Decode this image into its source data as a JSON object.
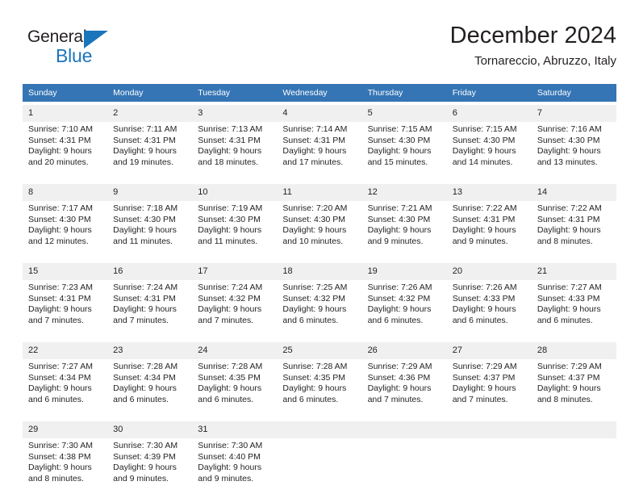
{
  "brand": {
    "name_part1": "General",
    "name_part2": "Blue",
    "accent_color": "#1b75bb",
    "triangle_icon": "logo-triangle-icon"
  },
  "header": {
    "title": "December 2024",
    "subtitle": "Tornareccio, Abruzzo, Italy"
  },
  "theme": {
    "header_row_bg": "#3575b5",
    "daynum_bg": "#f0f0f0",
    "text_color": "#231f20",
    "separator_color": "#3575b5"
  },
  "weekday_headers": [
    "Sunday",
    "Monday",
    "Tuesday",
    "Wednesday",
    "Thursday",
    "Friday",
    "Saturday"
  ],
  "labels": {
    "sunrise_prefix": "Sunrise:",
    "sunset_prefix": "Sunset:",
    "daylight_prefix": "Daylight:"
  },
  "weeks": [
    {
      "days": [
        {
          "num": "1",
          "sunrise": "Sunrise: 7:10 AM",
          "sunset": "Sunset: 4:31 PM",
          "daylight_line1": "Daylight: 9 hours",
          "daylight_line2": "and 20 minutes."
        },
        {
          "num": "2",
          "sunrise": "Sunrise: 7:11 AM",
          "sunset": "Sunset: 4:31 PM",
          "daylight_line1": "Daylight: 9 hours",
          "daylight_line2": "and 19 minutes."
        },
        {
          "num": "3",
          "sunrise": "Sunrise: 7:13 AM",
          "sunset": "Sunset: 4:31 PM",
          "daylight_line1": "Daylight: 9 hours",
          "daylight_line2": "and 18 minutes."
        },
        {
          "num": "4",
          "sunrise": "Sunrise: 7:14 AM",
          "sunset": "Sunset: 4:31 PM",
          "daylight_line1": "Daylight: 9 hours",
          "daylight_line2": "and 17 minutes."
        },
        {
          "num": "5",
          "sunrise": "Sunrise: 7:15 AM",
          "sunset": "Sunset: 4:30 PM",
          "daylight_line1": "Daylight: 9 hours",
          "daylight_line2": "and 15 minutes."
        },
        {
          "num": "6",
          "sunrise": "Sunrise: 7:15 AM",
          "sunset": "Sunset: 4:30 PM",
          "daylight_line1": "Daylight: 9 hours",
          "daylight_line2": "and 14 minutes."
        },
        {
          "num": "7",
          "sunrise": "Sunrise: 7:16 AM",
          "sunset": "Sunset: 4:30 PM",
          "daylight_line1": "Daylight: 9 hours",
          "daylight_line2": "and 13 minutes."
        }
      ]
    },
    {
      "days": [
        {
          "num": "8",
          "sunrise": "Sunrise: 7:17 AM",
          "sunset": "Sunset: 4:30 PM",
          "daylight_line1": "Daylight: 9 hours",
          "daylight_line2": "and 12 minutes."
        },
        {
          "num": "9",
          "sunrise": "Sunrise: 7:18 AM",
          "sunset": "Sunset: 4:30 PM",
          "daylight_line1": "Daylight: 9 hours",
          "daylight_line2": "and 11 minutes."
        },
        {
          "num": "10",
          "sunrise": "Sunrise: 7:19 AM",
          "sunset": "Sunset: 4:30 PM",
          "daylight_line1": "Daylight: 9 hours",
          "daylight_line2": "and 11 minutes."
        },
        {
          "num": "11",
          "sunrise": "Sunrise: 7:20 AM",
          "sunset": "Sunset: 4:30 PM",
          "daylight_line1": "Daylight: 9 hours",
          "daylight_line2": "and 10 minutes."
        },
        {
          "num": "12",
          "sunrise": "Sunrise: 7:21 AM",
          "sunset": "Sunset: 4:30 PM",
          "daylight_line1": "Daylight: 9 hours",
          "daylight_line2": "and 9 minutes."
        },
        {
          "num": "13",
          "sunrise": "Sunrise: 7:22 AM",
          "sunset": "Sunset: 4:31 PM",
          "daylight_line1": "Daylight: 9 hours",
          "daylight_line2": "and 9 minutes."
        },
        {
          "num": "14",
          "sunrise": "Sunrise: 7:22 AM",
          "sunset": "Sunset: 4:31 PM",
          "daylight_line1": "Daylight: 9 hours",
          "daylight_line2": "and 8 minutes."
        }
      ]
    },
    {
      "days": [
        {
          "num": "15",
          "sunrise": "Sunrise: 7:23 AM",
          "sunset": "Sunset: 4:31 PM",
          "daylight_line1": "Daylight: 9 hours",
          "daylight_line2": "and 7 minutes."
        },
        {
          "num": "16",
          "sunrise": "Sunrise: 7:24 AM",
          "sunset": "Sunset: 4:31 PM",
          "daylight_line1": "Daylight: 9 hours",
          "daylight_line2": "and 7 minutes."
        },
        {
          "num": "17",
          "sunrise": "Sunrise: 7:24 AM",
          "sunset": "Sunset: 4:32 PM",
          "daylight_line1": "Daylight: 9 hours",
          "daylight_line2": "and 7 minutes."
        },
        {
          "num": "18",
          "sunrise": "Sunrise: 7:25 AM",
          "sunset": "Sunset: 4:32 PM",
          "daylight_line1": "Daylight: 9 hours",
          "daylight_line2": "and 6 minutes."
        },
        {
          "num": "19",
          "sunrise": "Sunrise: 7:26 AM",
          "sunset": "Sunset: 4:32 PM",
          "daylight_line1": "Daylight: 9 hours",
          "daylight_line2": "and 6 minutes."
        },
        {
          "num": "20",
          "sunrise": "Sunrise: 7:26 AM",
          "sunset": "Sunset: 4:33 PM",
          "daylight_line1": "Daylight: 9 hours",
          "daylight_line2": "and 6 minutes."
        },
        {
          "num": "21",
          "sunrise": "Sunrise: 7:27 AM",
          "sunset": "Sunset: 4:33 PM",
          "daylight_line1": "Daylight: 9 hours",
          "daylight_line2": "and 6 minutes."
        }
      ]
    },
    {
      "days": [
        {
          "num": "22",
          "sunrise": "Sunrise: 7:27 AM",
          "sunset": "Sunset: 4:34 PM",
          "daylight_line1": "Daylight: 9 hours",
          "daylight_line2": "and 6 minutes."
        },
        {
          "num": "23",
          "sunrise": "Sunrise: 7:28 AM",
          "sunset": "Sunset: 4:34 PM",
          "daylight_line1": "Daylight: 9 hours",
          "daylight_line2": "and 6 minutes."
        },
        {
          "num": "24",
          "sunrise": "Sunrise: 7:28 AM",
          "sunset": "Sunset: 4:35 PM",
          "daylight_line1": "Daylight: 9 hours",
          "daylight_line2": "and 6 minutes."
        },
        {
          "num": "25",
          "sunrise": "Sunrise: 7:28 AM",
          "sunset": "Sunset: 4:35 PM",
          "daylight_line1": "Daylight: 9 hours",
          "daylight_line2": "and 6 minutes."
        },
        {
          "num": "26",
          "sunrise": "Sunrise: 7:29 AM",
          "sunset": "Sunset: 4:36 PM",
          "daylight_line1": "Daylight: 9 hours",
          "daylight_line2": "and 7 minutes."
        },
        {
          "num": "27",
          "sunrise": "Sunrise: 7:29 AM",
          "sunset": "Sunset: 4:37 PM",
          "daylight_line1": "Daylight: 9 hours",
          "daylight_line2": "and 7 minutes."
        },
        {
          "num": "28",
          "sunrise": "Sunrise: 7:29 AM",
          "sunset": "Sunset: 4:37 PM",
          "daylight_line1": "Daylight: 9 hours",
          "daylight_line2": "and 8 minutes."
        }
      ]
    },
    {
      "days": [
        {
          "num": "29",
          "sunrise": "Sunrise: 7:30 AM",
          "sunset": "Sunset: 4:38 PM",
          "daylight_line1": "Daylight: 9 hours",
          "daylight_line2": "and 8 minutes."
        },
        {
          "num": "30",
          "sunrise": "Sunrise: 7:30 AM",
          "sunset": "Sunset: 4:39 PM",
          "daylight_line1": "Daylight: 9 hours",
          "daylight_line2": "and 9 minutes."
        },
        {
          "num": "31",
          "sunrise": "Sunrise: 7:30 AM",
          "sunset": "Sunset: 4:40 PM",
          "daylight_line1": "Daylight: 9 hours",
          "daylight_line2": "and 9 minutes."
        },
        {
          "num": "",
          "sunrise": "",
          "sunset": "",
          "daylight_line1": "",
          "daylight_line2": ""
        },
        {
          "num": "",
          "sunrise": "",
          "sunset": "",
          "daylight_line1": "",
          "daylight_line2": ""
        },
        {
          "num": "",
          "sunrise": "",
          "sunset": "",
          "daylight_line1": "",
          "daylight_line2": ""
        },
        {
          "num": "",
          "sunrise": "",
          "sunset": "",
          "daylight_line1": "",
          "daylight_line2": ""
        }
      ]
    }
  ]
}
